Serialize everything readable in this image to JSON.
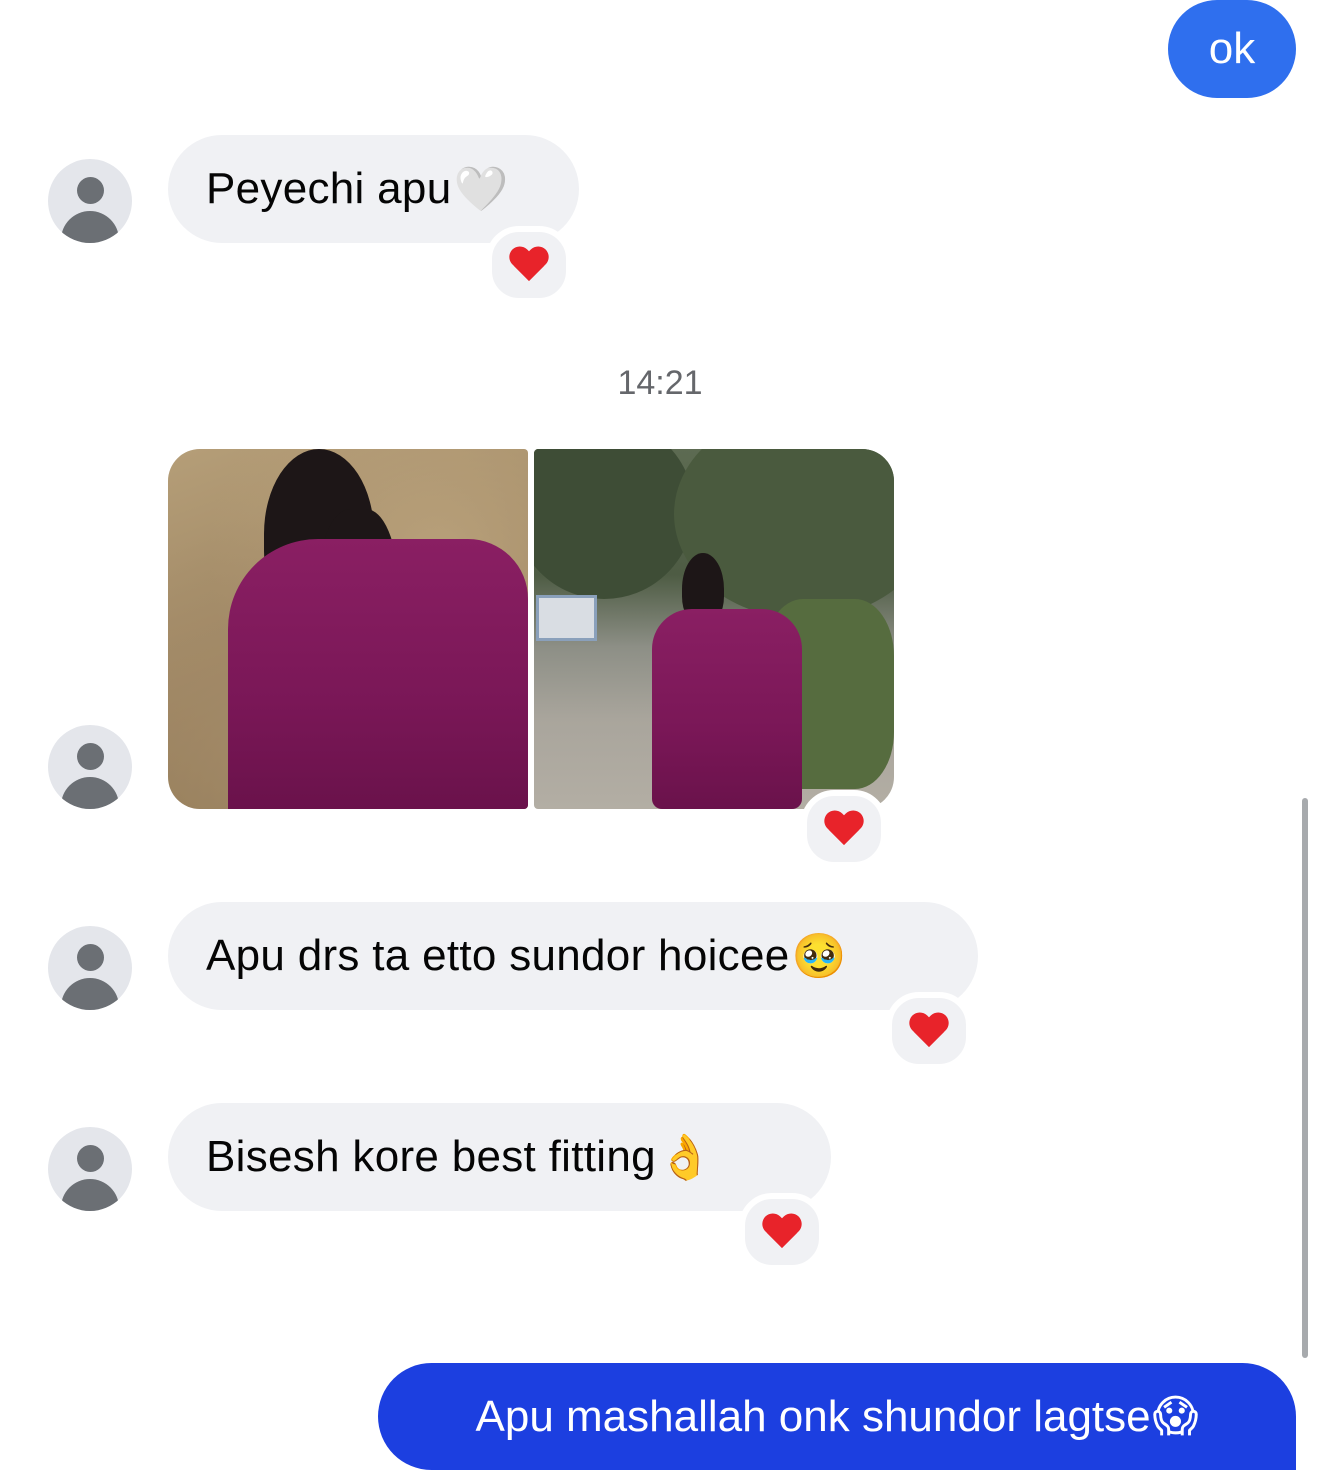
{
  "messages": {
    "outgoing_top": "ok",
    "incoming_1": "Peyechi apu",
    "incoming_1_emoji": "🤍",
    "timestamp": "14:21",
    "incoming_3": "Apu drs ta etto sundor hoicee",
    "incoming_3_emoji": "🥹",
    "incoming_4": "Bisesh kore best fitting",
    "incoming_4_emoji": "👌",
    "outgoing_bottom": "Apu mashallah onk shundor lagtse",
    "outgoing_bottom_emoji": "😱"
  },
  "reactions": {
    "incoming_1": "❤️",
    "photos": "❤️",
    "incoming_3": "❤️",
    "incoming_4": "❤️"
  },
  "photos": [
    "photo of a girl in a magenta dress sitting on dry grass",
    "photo of a girl in a magenta dress standing near palm trees"
  ],
  "icons": {
    "avatar": "default-user-avatar-icon",
    "reaction": "red-heart-icon"
  },
  "colors": {
    "outgoing_top_bubble": "#2f6fee",
    "outgoing_bottom_bubble": "#1c3fe0",
    "incoming_bubble": "#f0f1f4",
    "avatar_bg": "#e4e6eb",
    "avatar_fg": "#6b6f74",
    "timestamp_text": "#65676b",
    "heart": "#e8232a"
  }
}
